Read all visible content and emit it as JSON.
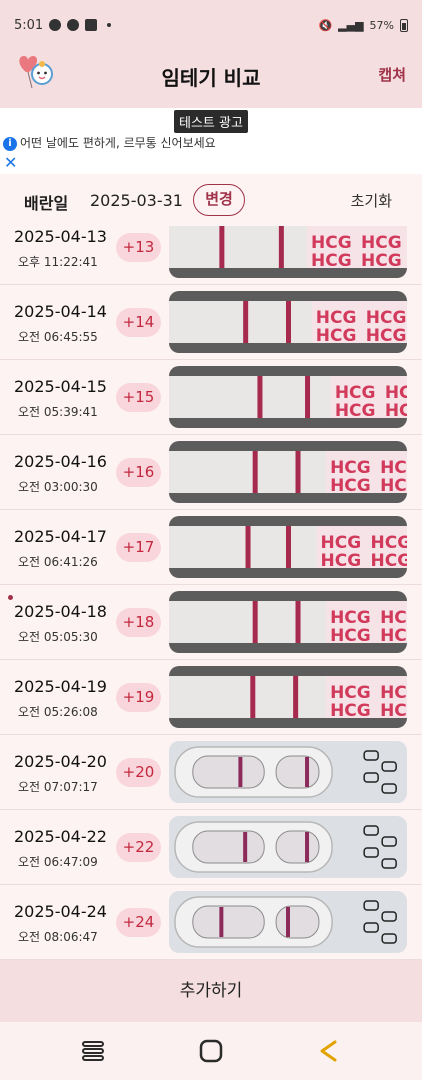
{
  "status_bar": {
    "time": "5:01",
    "battery": "57%"
  },
  "header": {
    "title": "임테기 비교",
    "capture_label": "캡쳐"
  },
  "ad": {
    "tag": "테스트 광고",
    "text": "어떤 날에도 편하게, 르무통 신어보세요"
  },
  "ovulation": {
    "label": "배란일",
    "date": "2025-03-31",
    "change_label": "변경",
    "reset_label": "초기화"
  },
  "tests": [
    {
      "date": "2025-04-13",
      "time": "오후 11:22:41",
      "dpo": "+13",
      "style": "strip",
      "lines": [
        0.22,
        0.47
      ],
      "hcg_at": 0.58
    },
    {
      "date": "2025-04-14",
      "time": "오전 06:45:55",
      "dpo": "+14",
      "style": "strip",
      "lines": [
        0.32,
        0.5
      ],
      "hcg_at": 0.6
    },
    {
      "date": "2025-04-15",
      "time": "오전 05:39:41",
      "dpo": "+15",
      "style": "strip",
      "lines": [
        0.38,
        0.58
      ],
      "hcg_at": 0.68
    },
    {
      "date": "2025-04-16",
      "time": "오전 03:00:30",
      "dpo": "+16",
      "style": "strip",
      "lines": [
        0.36,
        0.54
      ],
      "hcg_at": 0.66
    },
    {
      "date": "2025-04-17",
      "time": "오전 06:41:26",
      "dpo": "+17",
      "style": "strip",
      "lines": [
        0.33,
        0.5
      ],
      "hcg_at": 0.62
    },
    {
      "date": "2025-04-18",
      "time": "오전 05:05:30",
      "dpo": "+18",
      "style": "strip",
      "lines": [
        0.36,
        0.54
      ],
      "hcg_at": 0.66,
      "marked": true
    },
    {
      "date": "2025-04-19",
      "time": "오전 05:26:08",
      "dpo": "+19",
      "style": "strip",
      "lines": [
        0.35,
        0.53
      ],
      "hcg_at": 0.66
    },
    {
      "date": "2025-04-20",
      "time": "오전 07:07:17",
      "dpo": "+20",
      "style": "cassette",
      "lines": [
        0.3,
        0.58
      ]
    },
    {
      "date": "2025-04-22",
      "time": "오전 06:47:09",
      "dpo": "+22",
      "style": "cassette",
      "lines": [
        0.32,
        0.58
      ]
    },
    {
      "date": "2025-04-24",
      "time": "오전 08:06:47",
      "dpo": "+24",
      "style": "cassette",
      "lines": [
        0.22,
        0.5
      ]
    }
  ],
  "add_label": "추가하기",
  "icons": {
    "logo": "heart-balloon-logo-icon",
    "recents": "recent-apps-icon",
    "home": "home-icon",
    "back": "back-icon"
  },
  "colors": {
    "accent": "#a0334a",
    "header_bg": "#f4dedf",
    "badge_bg": "#f9d6dc",
    "badge_text": "#c3283f"
  }
}
